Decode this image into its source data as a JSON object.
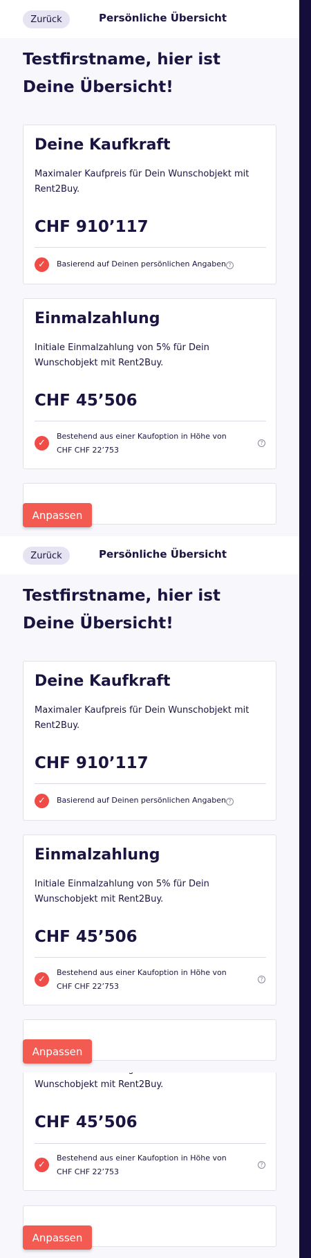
{
  "header": {
    "back_label": "Zurück",
    "title": "Persönliche Übersicht"
  },
  "headline": "Testfirstname, hier ist Deine Übersicht!",
  "purchasing_power": {
    "title": "Deine Kaufkraft",
    "description": "Maximaler Kaufpreis für Dein Wunschobjekt mit Rent2Buy.",
    "amount": "CHF 910’117",
    "note": "Basierend auf Deinen persönlichen Angaben"
  },
  "down_payment": {
    "title": "Einmalzahlung",
    "description": "Initiale Einmalzahlung von 5% für Dein Wunschobjekt mit Rent2Buy.",
    "amount": "CHF 45’506",
    "note": "Bestehend aus einer Kaufoption in Höhe von CHF CHF 22’753"
  },
  "cta_label": "Anpassen",
  "icons": {
    "check": "check-circle-icon",
    "help": "question-circle-icon"
  },
  "colors": {
    "accent": "#f25a52",
    "check": "#f04c47",
    "text": "#1a1440",
    "rail": "#150d3a",
    "background": "#f7f7fc"
  }
}
